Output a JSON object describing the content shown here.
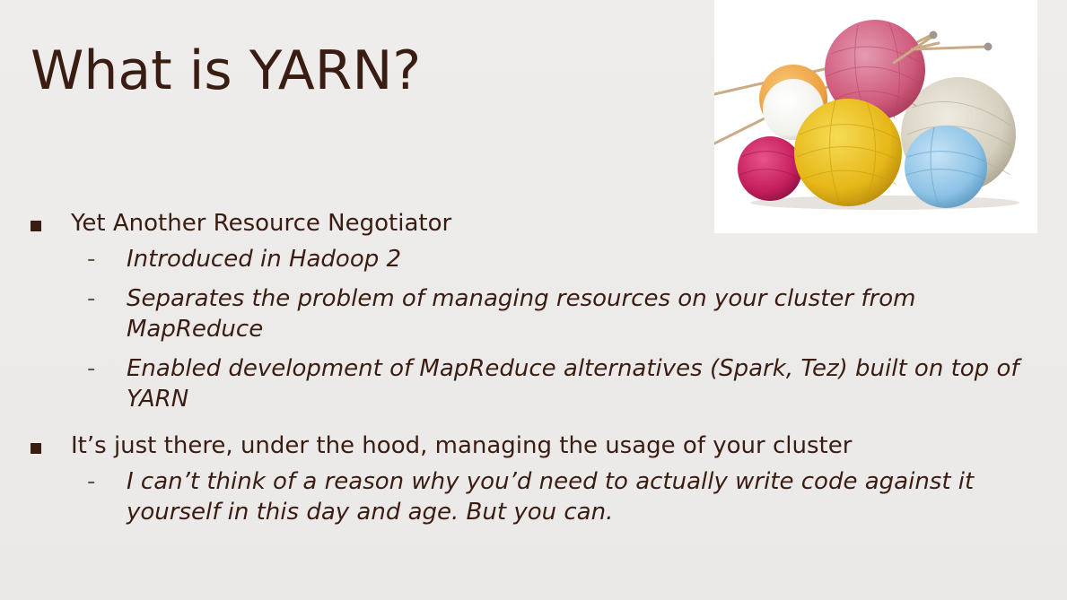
{
  "slide": {
    "title": "What is YARN?",
    "image": {
      "description_icon": "yarn-balls-icon"
    },
    "bullets": [
      {
        "text": "Yet Another Resource Negotiator",
        "sub": [
          "Introduced in Hadoop 2",
          "Separates the problem of managing resources on your cluster from MapReduce",
          "Enabled development of MapReduce alternatives (Spark, Tez) built on top of YARN"
        ]
      },
      {
        "text": "It’s just there, under the hood, managing the usage of your cluster",
        "sub": [
          "I can’t think of a reason why you’d need to actually write code against it yourself in this day and age. But you can."
        ]
      }
    ],
    "dash": "-"
  },
  "colors": {
    "background": "#edebe9",
    "text": "#3a1d12",
    "pink": "#d2577a",
    "yellow": "#e7b817",
    "magenta": "#c41f5c",
    "beige": "#d6d0c0",
    "blue": "#8ec3e6",
    "white": "#f4f4f1",
    "orange": "#eea64a"
  }
}
